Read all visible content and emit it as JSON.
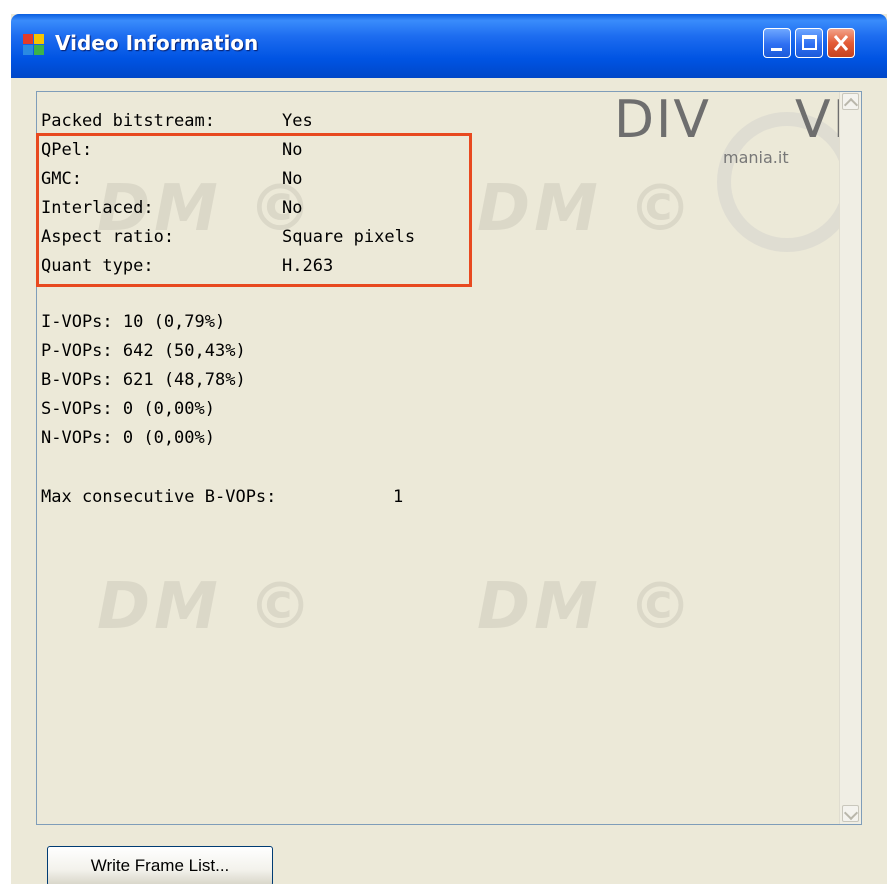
{
  "window": {
    "title": "Video Information",
    "accent_color": "#0054e3",
    "close_color": "#e45c36",
    "highlight_color": "#e8491f"
  },
  "watermark": {
    "logo_text_left": "DIV",
    "logo_text_right": "VID",
    "logo_sub": "mania.it",
    "repeat_text": "DM ©"
  },
  "info": {
    "packed_bitstream": {
      "label": "Packed bitstream:",
      "value": "Yes"
    },
    "qpel": {
      "label": "QPel:",
      "value": "No"
    },
    "gmc": {
      "label": "GMC:",
      "value": "No"
    },
    "interlaced": {
      "label": "Interlaced:",
      "value": "No"
    },
    "aspect_ratio": {
      "label": "Aspect ratio:",
      "value": "Square pixels"
    },
    "quant_type": {
      "label": "Quant type:",
      "value": "H.263"
    }
  },
  "vops": [
    "I-VOPs: 10 (0,79%)",
    "P-VOPs: 642 (50,43%)",
    "B-VOPs: 621 (48,78%)",
    "S-VOPs: 0 (0,00%)",
    "N-VOPs: 0 (0,00%)"
  ],
  "max_consecutive": {
    "label": "Max consecutive B-VOPs:",
    "value": "1"
  },
  "buttons": {
    "write_frame_list": "Write Frame List..."
  },
  "icons": {
    "app": "app-window-icon",
    "minimize": "minimize-icon",
    "maximize": "maximize-icon",
    "close": "close-icon",
    "scroll_up": "chevron-up-icon",
    "scroll_down": "chevron-down-icon"
  }
}
